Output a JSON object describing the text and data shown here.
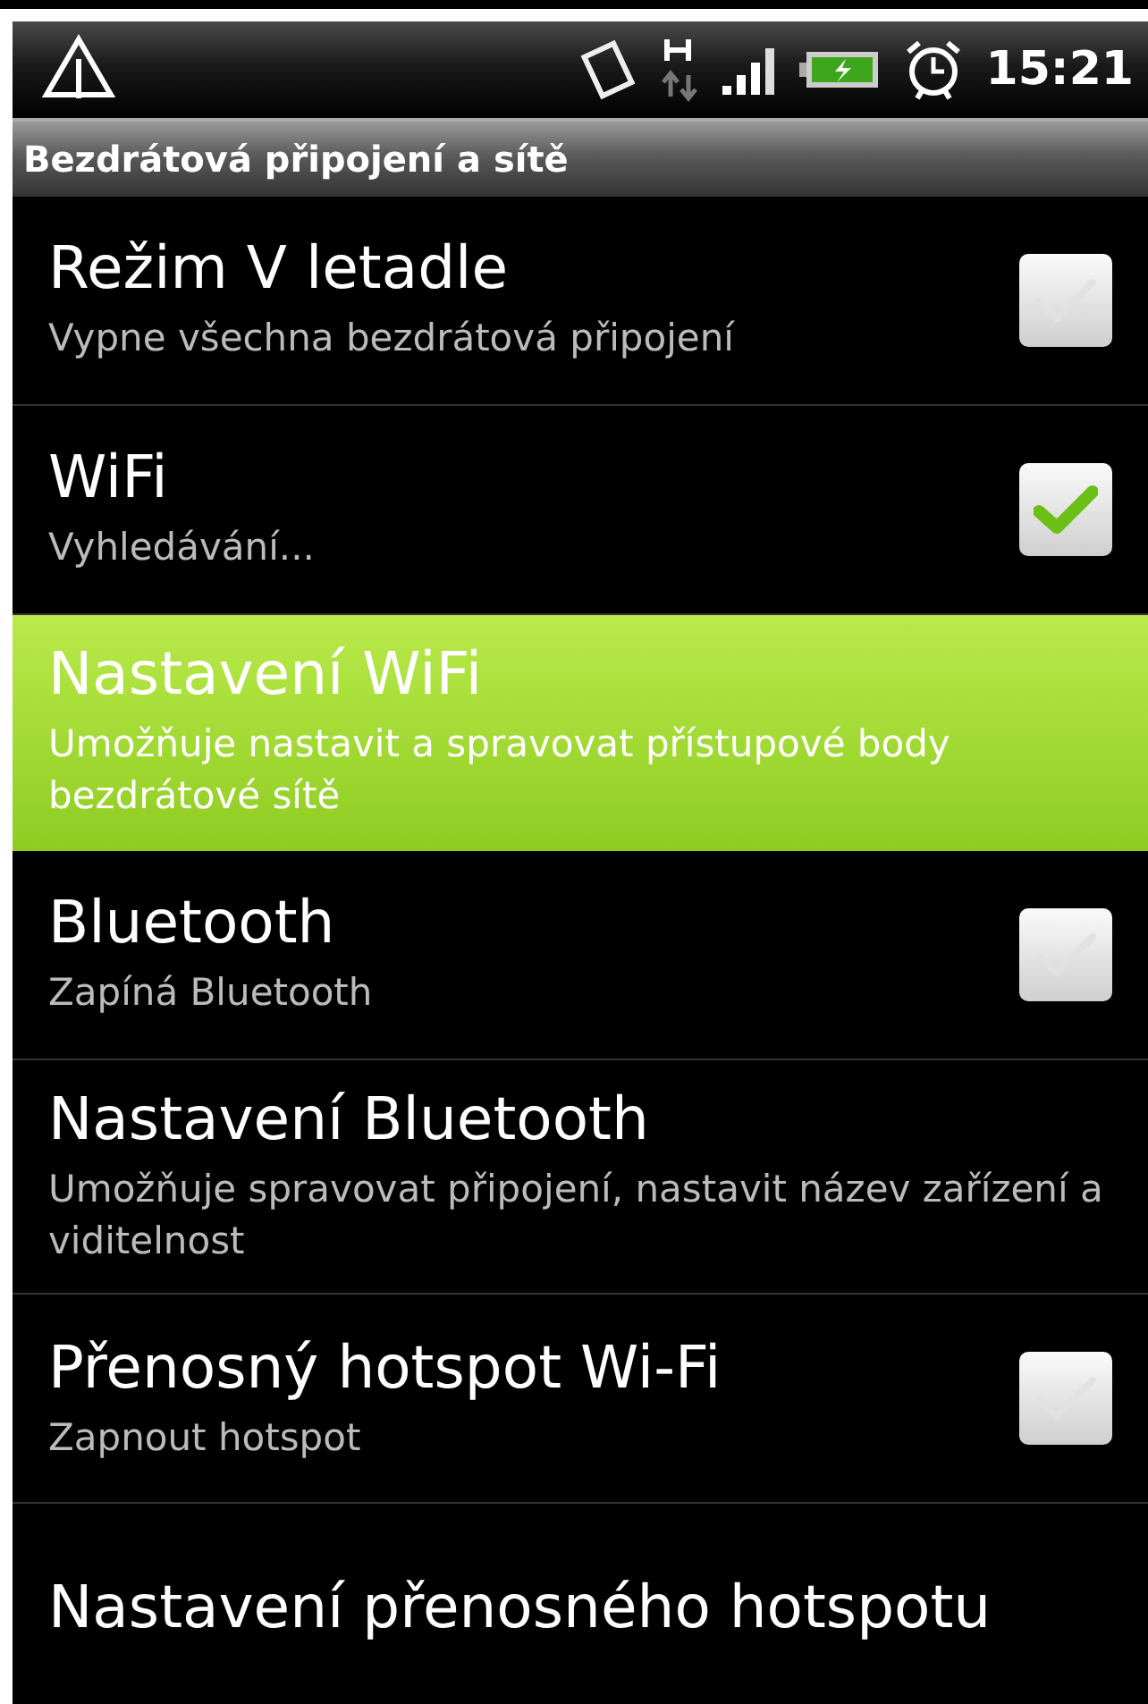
{
  "status_bar": {
    "time": "15:21"
  },
  "section": {
    "title": "Bezdrátová připojení a sítě"
  },
  "items": [
    {
      "kind": "checkbox",
      "title": "Režim V letadle",
      "summary": "Vypne všechna bezdrátová připojení",
      "checked": false,
      "selected": false
    },
    {
      "kind": "checkbox",
      "title": "WiFi",
      "summary": "Vyhledávání...",
      "checked": true,
      "selected": false
    },
    {
      "kind": "link",
      "title": "Nastavení WiFi",
      "summary": "Umožňuje nastavit a spravovat přístupové body bezdrátové sítě",
      "selected": true
    },
    {
      "kind": "checkbox",
      "title": "Bluetooth",
      "summary": "Zapíná Bluetooth",
      "checked": false,
      "selected": false
    },
    {
      "kind": "link",
      "title": "Nastavení Bluetooth",
      "summary": "Umožňuje spravovat připojení, nastavit název zařízení a viditelnost",
      "selected": false
    },
    {
      "kind": "checkbox",
      "title": "Přenosný hotspot Wi-Fi",
      "summary": "Zapnout hotspot",
      "checked": false,
      "selected": false
    },
    {
      "kind": "link",
      "title": "Nastavení přenosného hotspotu",
      "selected": false
    }
  ]
}
